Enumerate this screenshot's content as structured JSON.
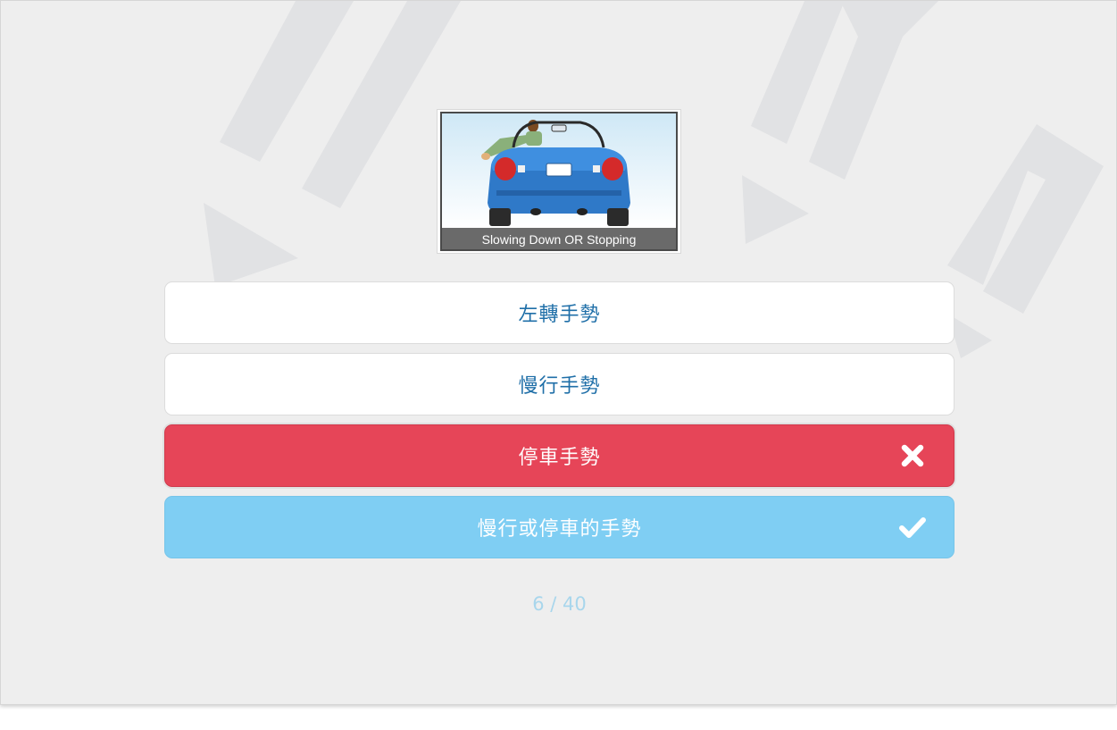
{
  "question": {
    "image": {
      "caption": "Slowing Down OR Stopping",
      "icon": "car-rear-hand-signal-image"
    }
  },
  "options": [
    {
      "label": "左轉手勢",
      "state": "default"
    },
    {
      "label": "慢行手勢",
      "state": "default"
    },
    {
      "label": "停車手勢",
      "state": "wrong",
      "icon": "close-icon"
    },
    {
      "label": "慢行或停車的手勢",
      "state": "correct",
      "icon": "check-icon"
    }
  ],
  "progress": {
    "current": 6,
    "total": 40,
    "text": "6 / 40"
  },
  "colors": {
    "background": "#eeeeee",
    "option_text": "#1f6fa8",
    "wrong": "#e64558",
    "correct": "#7fcef3",
    "counter": "#a8d6ec"
  }
}
